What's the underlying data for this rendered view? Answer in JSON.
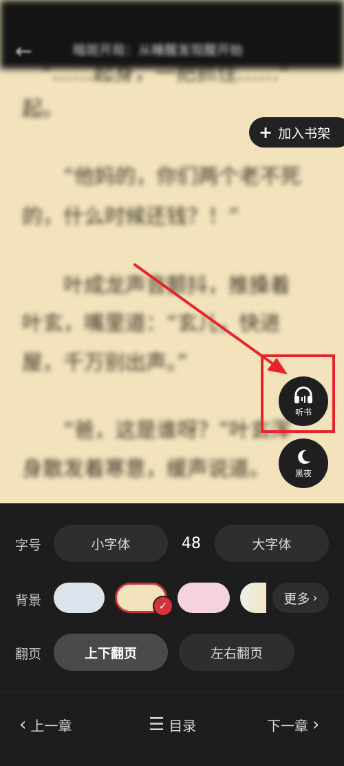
{
  "header": {
    "title": "暗斑开局：从睡醒发现醒开始",
    "back_icon": "arrow-left-icon"
  },
  "content": {
    "paragraphs": [
      "“……起身，一把抓住……”",
      "起。",
      "“他妈的，你们两个老不死",
      "的，什么时候还钱？！”",
      "叶成龙声音颤抖，推搡着",
      "叶玄，嘴里道：“玄儿，快进",
      "屋，千万别出声。”",
      "“爸，这是谁呀？”叶玄浑",
      "身散发着寒意，缓声说道。"
    ]
  },
  "bookshelf": {
    "label": "加入书架"
  },
  "fabs": {
    "listen": {
      "label": "听书",
      "icon": "headphones-icon"
    },
    "night": {
      "label": "黑夜",
      "icon": "moon-icon"
    }
  },
  "settings": {
    "font_size": {
      "label": "字号",
      "smaller": "小字体",
      "value": "48",
      "larger": "大字体"
    },
    "background": {
      "label": "背景",
      "more": "更多",
      "selected_index": 1,
      "swatches": [
        "#dde3ec",
        "#f2e3bd",
        "#f4d3dd",
        "#eceee2"
      ]
    },
    "page_turn": {
      "label": "翻页",
      "vertical": "上下翻页",
      "horizontal": "左右翻页",
      "selected": "vertical"
    }
  },
  "bottom_nav": {
    "prev": "上一章",
    "toc": "目录",
    "next": "下一章"
  },
  "colors": {
    "annotation_red": "#e8242a",
    "paper": "#f2e3bd",
    "panel": "#1d1d1d"
  }
}
